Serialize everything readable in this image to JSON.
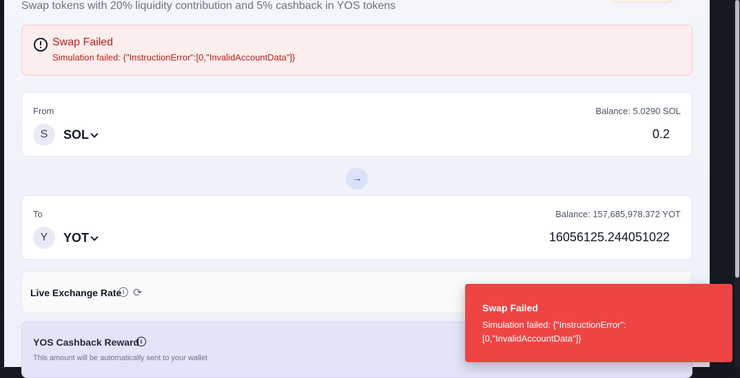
{
  "header": {
    "subtitle": "Swap tokens with 20% liquidity contribution and 5% cashback in YOS tokens"
  },
  "error_alert": {
    "title": "Swap Failed",
    "message": "Simulation failed: {\"InstructionError\":[0,\"InvalidAccountData\"]}",
    "icon": "alert-circle-icon"
  },
  "from_card": {
    "label": "From",
    "balance": "Balance: 5.0290 SOL",
    "token_initial": "S",
    "token_symbol": "SOL",
    "amount": "0.2"
  },
  "swap_direction": {
    "icon": "arrow-right-icon"
  },
  "to_card": {
    "label": "To",
    "balance": "Balance: 157,685,978.372 YOT",
    "token_initial": "Y",
    "token_symbol": "YOT",
    "amount": "16056125.244051022"
  },
  "exchange_rate": {
    "label": "Live Exchange Rate",
    "icons": [
      "info-icon",
      "refresh-icon"
    ]
  },
  "cashback": {
    "title": "YOS Cashback Reward",
    "description": "This amount will be automatically sent to your wallet"
  },
  "toast": {
    "title": "Swap Failed",
    "message": "Simulation failed: {\"InstructionError\":[0,\"InvalidAccountData\"]}"
  },
  "colors": {
    "error_red": "#b91c1c",
    "toast_red": "#ef4444",
    "accent_blue": "#2563eb"
  }
}
